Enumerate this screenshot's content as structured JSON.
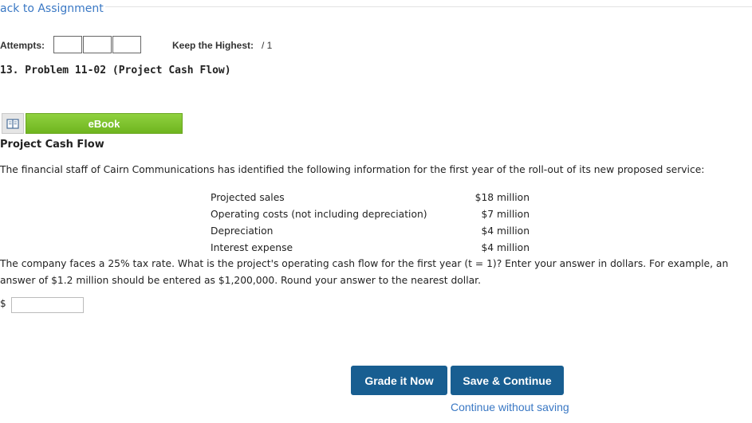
{
  "nav": {
    "back_link": "ack to Assignment"
  },
  "attempts": {
    "label": "Attempts:",
    "keep_label": "Keep the Highest:",
    "keep_value": "/ 1"
  },
  "problem": {
    "title": "13.  Problem 11-02 (Project Cash Flow)"
  },
  "ebook": {
    "label": "eBook",
    "icon": "book-icon"
  },
  "content": {
    "section_title": "Project Cash Flow",
    "intro": "The financial staff of Cairn Communications has identified the following information for the first year of the roll-out of its new proposed service:",
    "rows": [
      {
        "label": "Projected sales",
        "value": "$18 million"
      },
      {
        "label": "Operating costs (not including depreciation)",
        "value": "$7 million"
      },
      {
        "label": "Depreciation",
        "value": "$4 million"
      },
      {
        "label": "Interest expense",
        "value": "$4 million"
      }
    ],
    "question": "The company faces a 25% tax rate. What is the project's operating cash flow for the first year (t = 1)? Enter your answer in dollars. For example, an answer of $1.2 million should be entered as $1,200,000. Round your answer to the nearest dollar.",
    "currency": "$",
    "answer_value": ""
  },
  "actions": {
    "grade": "Grade it Now",
    "save": "Save & Continue",
    "continue": "Continue without saving"
  },
  "colors": {
    "link": "#3a78c4",
    "button": "#185e91",
    "ebook": "#7cc22b"
  }
}
